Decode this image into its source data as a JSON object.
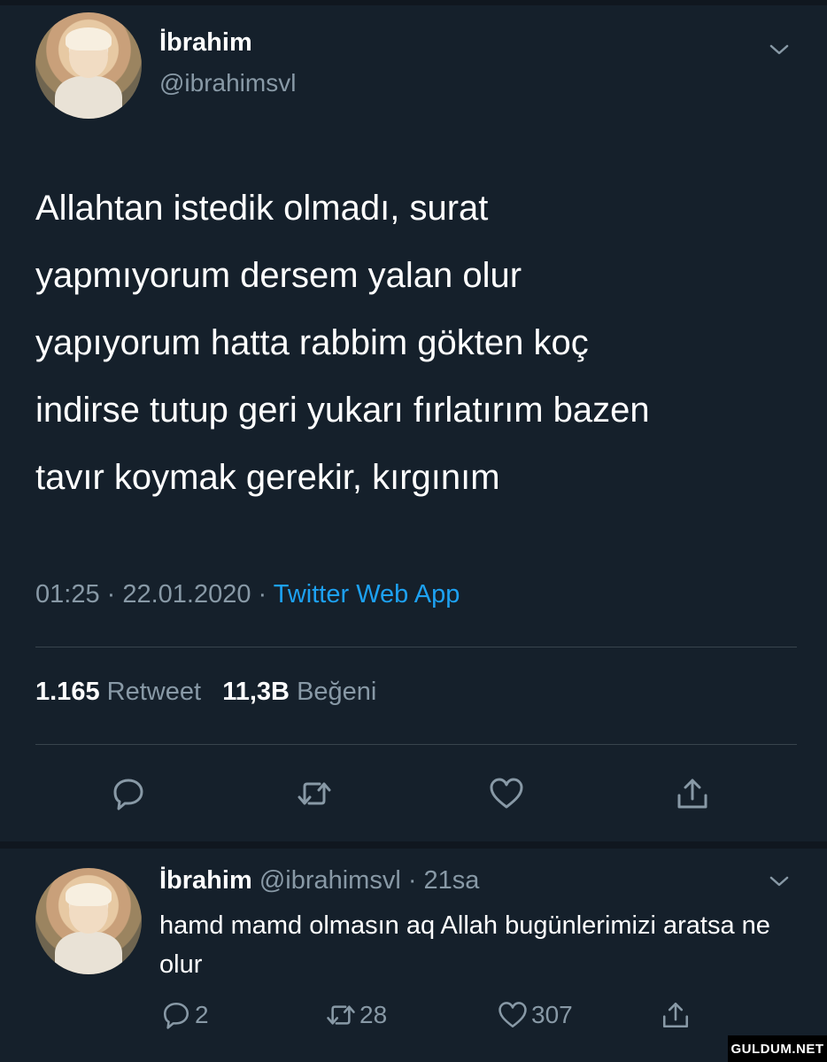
{
  "tweet": {
    "name": "İbrahim",
    "handle": "@ibrahimsvl",
    "text": "Allahtan istedik olmadı, surat\nyapmıyorum dersem yalan olur\nyapıyorum hatta rabbim gökten koç\nindirse tutup geri yukarı fırlatırım bazen\ntavır koymak gerekir, kırgınım",
    "time": "01:25 · 22.01.2020 · ",
    "source": "Twitter Web App",
    "retweet_count": "1.165",
    "retweet_label": "Retweet",
    "like_count": "11,3B",
    "like_label": "Beğeni"
  },
  "reply": {
    "name": "İbrahim",
    "handle_time": "@ibrahimsvl · 21sa",
    "text": "hamd mamd olmasın aq Allah bugünlerimizi aratsa ne olur",
    "reply_count": "2",
    "retweet_count": "28",
    "like_count": "307"
  },
  "watermark": "GULDUM.NET",
  "icons": [
    "chevron-down-icon",
    "reply-icon",
    "retweet-icon",
    "like-icon",
    "share-icon"
  ],
  "colors": {
    "background": "#15202b",
    "accent": "#1da1f2",
    "muted": "#8899a6",
    "divider": "#38444d"
  }
}
